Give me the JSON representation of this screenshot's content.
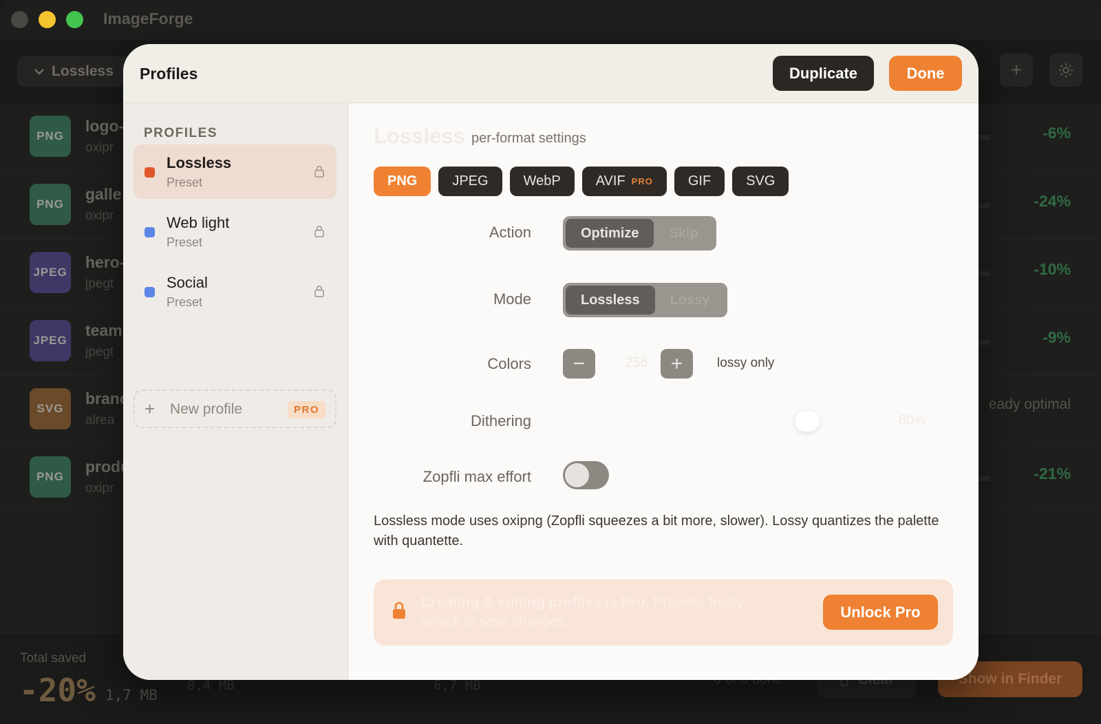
{
  "app": {
    "title": "ImageForge"
  },
  "background": {
    "profile_dropdown": "Lossless",
    "files": [
      {
        "badge": "PNG",
        "name": "logo-",
        "sub": "oxipr",
        "result": "-6%",
        "badge_color": "#2f5a46"
      },
      {
        "badge": "PNG",
        "name": "galle",
        "sub": "oxipr",
        "result": "-24%",
        "badge_color": "#2f5a46"
      },
      {
        "badge": "JPEG",
        "name": "hero-",
        "sub": "jpegt",
        "result": "-10%",
        "badge_color": "#3f3766"
      },
      {
        "badge": "JPEG",
        "name": "team",
        "sub": "jpegt",
        "result": "-9%",
        "badge_color": "#3f3766"
      },
      {
        "badge": "SVG",
        "name": "branc",
        "sub": "alrea",
        "result": "eady optimal",
        "badge_color": "#6b4a2a"
      },
      {
        "badge": "PNG",
        "name": "produ",
        "sub": "oxipr",
        "result": "-21%",
        "badge_color": "#2f5a46"
      }
    ],
    "footer": {
      "total_label": "Total saved",
      "total_pct": "-20%",
      "total_size": "1,7 MB",
      "before_size": "8,4 MB",
      "after_size": "6,7 MB",
      "done_text": "6 of 6 done",
      "clear_label": "Clear",
      "finder_label": "Show in Finder"
    }
  },
  "modal": {
    "title": "Profiles",
    "duplicate_label": "Duplicate",
    "done_label": "Done",
    "sidebar": {
      "heading": "PROFILES",
      "profiles": [
        {
          "name": "Lossless",
          "sub": "Preset",
          "color": "#e0582a",
          "selected": true
        },
        {
          "name": "Web light",
          "sub": "Preset",
          "color": "#5b86e5",
          "selected": false
        },
        {
          "name": "Social",
          "sub": "Preset",
          "color": "#5b86e5",
          "selected": false
        }
      ],
      "new_profile_label": "New profile",
      "new_profile_badge": "PRO"
    },
    "content": {
      "title": "Lossless",
      "subtitle": "per-format settings",
      "tabs": [
        {
          "label": "PNG",
          "active": true
        },
        {
          "label": "JPEG"
        },
        {
          "label": "WebP"
        },
        {
          "label": "AVIF",
          "badge": "PRO"
        },
        {
          "label": "GIF"
        },
        {
          "label": "SVG"
        }
      ],
      "action": {
        "label": "Action",
        "options": [
          "Optimize",
          "Skip"
        ],
        "selected": "Optimize"
      },
      "mode": {
        "label": "Mode",
        "options": [
          "Lossless",
          "Lossy"
        ],
        "selected": "Lossless"
      },
      "colors": {
        "label": "Colors",
        "value": "256",
        "minus": "−",
        "plus": "+",
        "note": "lossy only"
      },
      "dithering": {
        "label": "Dithering",
        "value": "80%",
        "level": 0.8
      },
      "zopfli": {
        "label": "Zopfli max effort",
        "on": false
      },
      "description": "Lossless mode uses oxipng (Zopfli squeezes a bit more, slower). Lossy quantizes the palette with quantette.",
      "promo": {
        "title": "Creating & editing profiles is Pro.",
        "title_rest": "Preview freely;",
        "sub": "unlock to save changes.",
        "button": "Unlock Pro"
      }
    }
  },
  "colors": {
    "accent": "#ee8132",
    "dark_button": "#2b2723"
  }
}
